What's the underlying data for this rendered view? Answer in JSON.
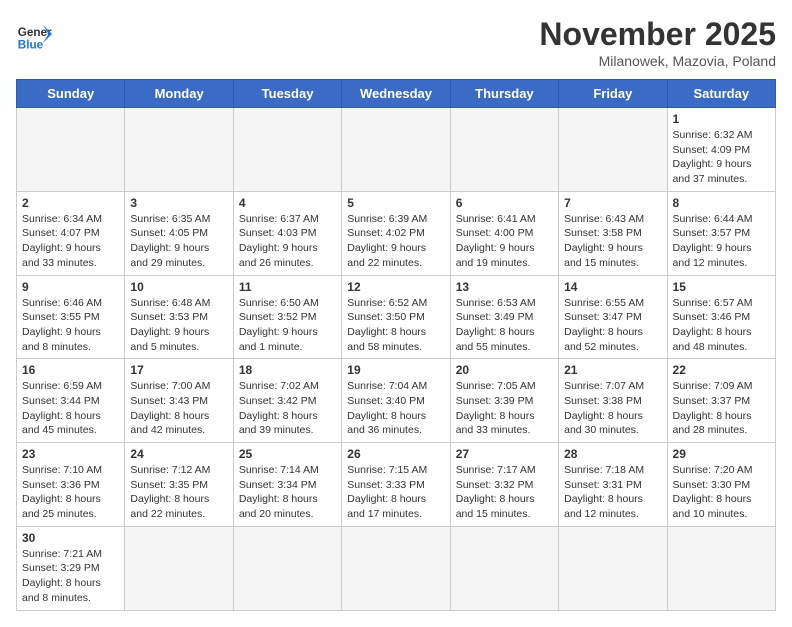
{
  "header": {
    "logo_general": "General",
    "logo_blue": "Blue",
    "month": "November 2025",
    "location": "Milanowek, Mazovia, Poland"
  },
  "weekdays": [
    "Sunday",
    "Monday",
    "Tuesday",
    "Wednesday",
    "Thursday",
    "Friday",
    "Saturday"
  ],
  "rows": [
    [
      {
        "day": "",
        "info": ""
      },
      {
        "day": "",
        "info": ""
      },
      {
        "day": "",
        "info": ""
      },
      {
        "day": "",
        "info": ""
      },
      {
        "day": "",
        "info": ""
      },
      {
        "day": "",
        "info": ""
      },
      {
        "day": "1",
        "info": "Sunrise: 6:32 AM\nSunset: 4:09 PM\nDaylight: 9 hours\nand 37 minutes."
      }
    ],
    [
      {
        "day": "2",
        "info": "Sunrise: 6:34 AM\nSunset: 4:07 PM\nDaylight: 9 hours\nand 33 minutes."
      },
      {
        "day": "3",
        "info": "Sunrise: 6:35 AM\nSunset: 4:05 PM\nDaylight: 9 hours\nand 29 minutes."
      },
      {
        "day": "4",
        "info": "Sunrise: 6:37 AM\nSunset: 4:03 PM\nDaylight: 9 hours\nand 26 minutes."
      },
      {
        "day": "5",
        "info": "Sunrise: 6:39 AM\nSunset: 4:02 PM\nDaylight: 9 hours\nand 22 minutes."
      },
      {
        "day": "6",
        "info": "Sunrise: 6:41 AM\nSunset: 4:00 PM\nDaylight: 9 hours\nand 19 minutes."
      },
      {
        "day": "7",
        "info": "Sunrise: 6:43 AM\nSunset: 3:58 PM\nDaylight: 9 hours\nand 15 minutes."
      },
      {
        "day": "8",
        "info": "Sunrise: 6:44 AM\nSunset: 3:57 PM\nDaylight: 9 hours\nand 12 minutes."
      }
    ],
    [
      {
        "day": "9",
        "info": "Sunrise: 6:46 AM\nSunset: 3:55 PM\nDaylight: 9 hours\nand 8 minutes."
      },
      {
        "day": "10",
        "info": "Sunrise: 6:48 AM\nSunset: 3:53 PM\nDaylight: 9 hours\nand 5 minutes."
      },
      {
        "day": "11",
        "info": "Sunrise: 6:50 AM\nSunset: 3:52 PM\nDaylight: 9 hours\nand 1 minute."
      },
      {
        "day": "12",
        "info": "Sunrise: 6:52 AM\nSunset: 3:50 PM\nDaylight: 8 hours\nand 58 minutes."
      },
      {
        "day": "13",
        "info": "Sunrise: 6:53 AM\nSunset: 3:49 PM\nDaylight: 8 hours\nand 55 minutes."
      },
      {
        "day": "14",
        "info": "Sunrise: 6:55 AM\nSunset: 3:47 PM\nDaylight: 8 hours\nand 52 minutes."
      },
      {
        "day": "15",
        "info": "Sunrise: 6:57 AM\nSunset: 3:46 PM\nDaylight: 8 hours\nand 48 minutes."
      }
    ],
    [
      {
        "day": "16",
        "info": "Sunrise: 6:59 AM\nSunset: 3:44 PM\nDaylight: 8 hours\nand 45 minutes."
      },
      {
        "day": "17",
        "info": "Sunrise: 7:00 AM\nSunset: 3:43 PM\nDaylight: 8 hours\nand 42 minutes."
      },
      {
        "day": "18",
        "info": "Sunrise: 7:02 AM\nSunset: 3:42 PM\nDaylight: 8 hours\nand 39 minutes."
      },
      {
        "day": "19",
        "info": "Sunrise: 7:04 AM\nSunset: 3:40 PM\nDaylight: 8 hours\nand 36 minutes."
      },
      {
        "day": "20",
        "info": "Sunrise: 7:05 AM\nSunset: 3:39 PM\nDaylight: 8 hours\nand 33 minutes."
      },
      {
        "day": "21",
        "info": "Sunrise: 7:07 AM\nSunset: 3:38 PM\nDaylight: 8 hours\nand 30 minutes."
      },
      {
        "day": "22",
        "info": "Sunrise: 7:09 AM\nSunset: 3:37 PM\nDaylight: 8 hours\nand 28 minutes."
      }
    ],
    [
      {
        "day": "23",
        "info": "Sunrise: 7:10 AM\nSunset: 3:36 PM\nDaylight: 8 hours\nand 25 minutes."
      },
      {
        "day": "24",
        "info": "Sunrise: 7:12 AM\nSunset: 3:35 PM\nDaylight: 8 hours\nand 22 minutes."
      },
      {
        "day": "25",
        "info": "Sunrise: 7:14 AM\nSunset: 3:34 PM\nDaylight: 8 hours\nand 20 minutes."
      },
      {
        "day": "26",
        "info": "Sunrise: 7:15 AM\nSunset: 3:33 PM\nDaylight: 8 hours\nand 17 minutes."
      },
      {
        "day": "27",
        "info": "Sunrise: 7:17 AM\nSunset: 3:32 PM\nDaylight: 8 hours\nand 15 minutes."
      },
      {
        "day": "28",
        "info": "Sunrise: 7:18 AM\nSunset: 3:31 PM\nDaylight: 8 hours\nand 12 minutes."
      },
      {
        "day": "29",
        "info": "Sunrise: 7:20 AM\nSunset: 3:30 PM\nDaylight: 8 hours\nand 10 minutes."
      }
    ],
    [
      {
        "day": "30",
        "info": "Sunrise: 7:21 AM\nSunset: 3:29 PM\nDaylight: 8 hours\nand 8 minutes."
      },
      {
        "day": "",
        "info": ""
      },
      {
        "day": "",
        "info": ""
      },
      {
        "day": "",
        "info": ""
      },
      {
        "day": "",
        "info": ""
      },
      {
        "day": "",
        "info": ""
      },
      {
        "day": "",
        "info": ""
      }
    ]
  ]
}
